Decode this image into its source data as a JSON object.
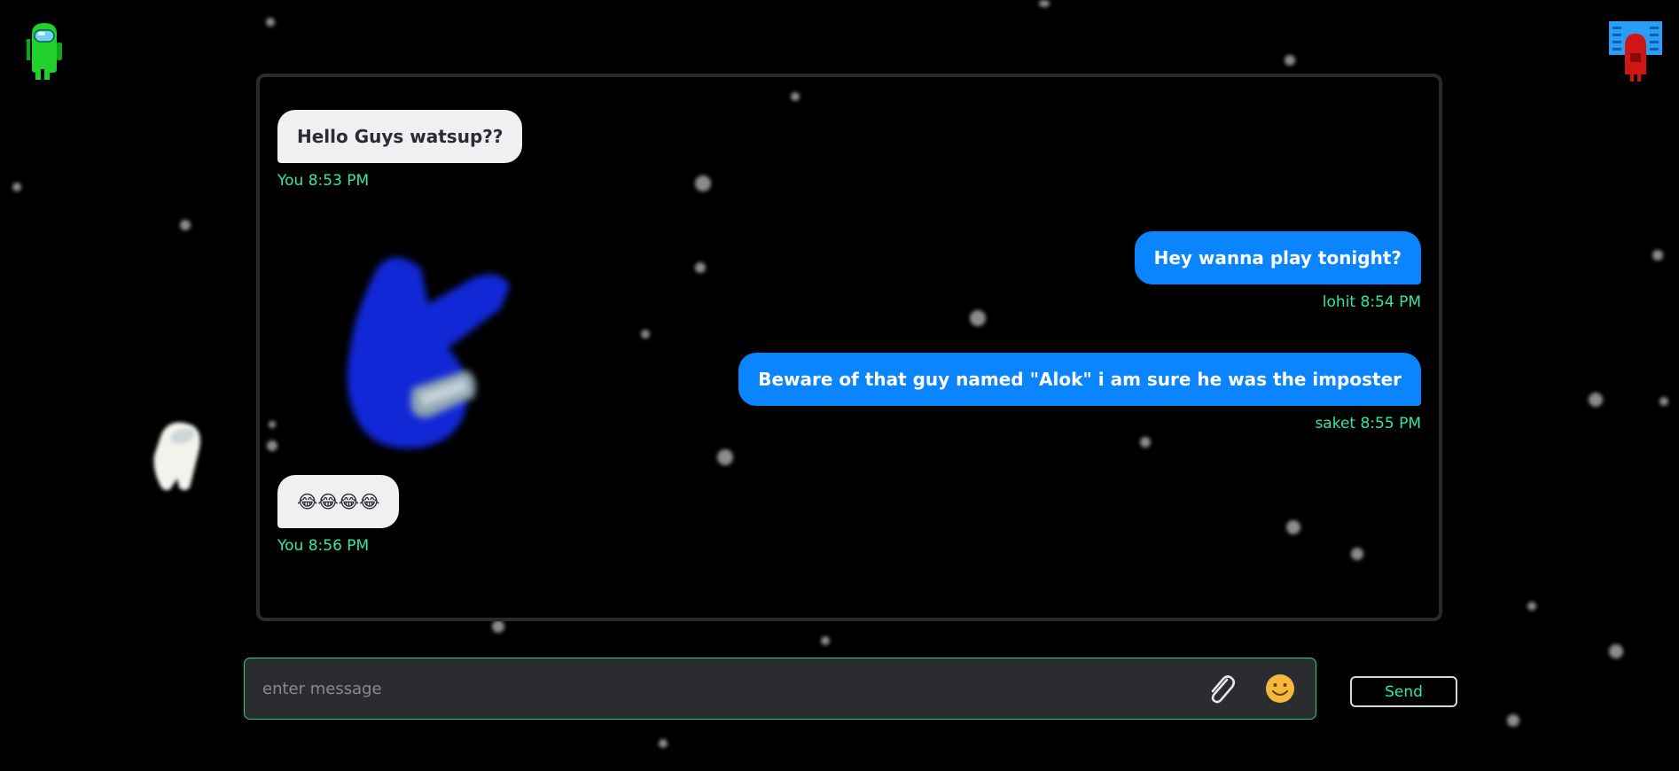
{
  "input": {
    "placeholder": "enter message"
  },
  "send_button": {
    "label": "Send"
  },
  "messages": [
    {
      "text": "Hello Guys watsup??",
      "sender": "You",
      "time": "8:53 PM"
    },
    {
      "text": "Hey wanna play tonight?",
      "sender": "lohit",
      "time": "8:54 PM"
    },
    {
      "text": "Beware of that guy named \"Alok\" i am sure he was the imposter",
      "sender": "saket",
      "time": "8:55 PM"
    },
    {
      "text": "😂😂😂😂",
      "sender": "You",
      "time": "8:56 PM"
    }
  ],
  "icons": {
    "attach": "paperclip-icon",
    "emoji": "smiley-icon",
    "left_avatar": "green-crewmate-icon",
    "right_avatar": "red-crewmate-vent-icon"
  },
  "colors": {
    "accent": "#33e7a4",
    "outgoing_bubble": "#0a84ff",
    "incoming_bubble": "#eef0f2",
    "input_border": "#23d483",
    "background": "#000000"
  }
}
